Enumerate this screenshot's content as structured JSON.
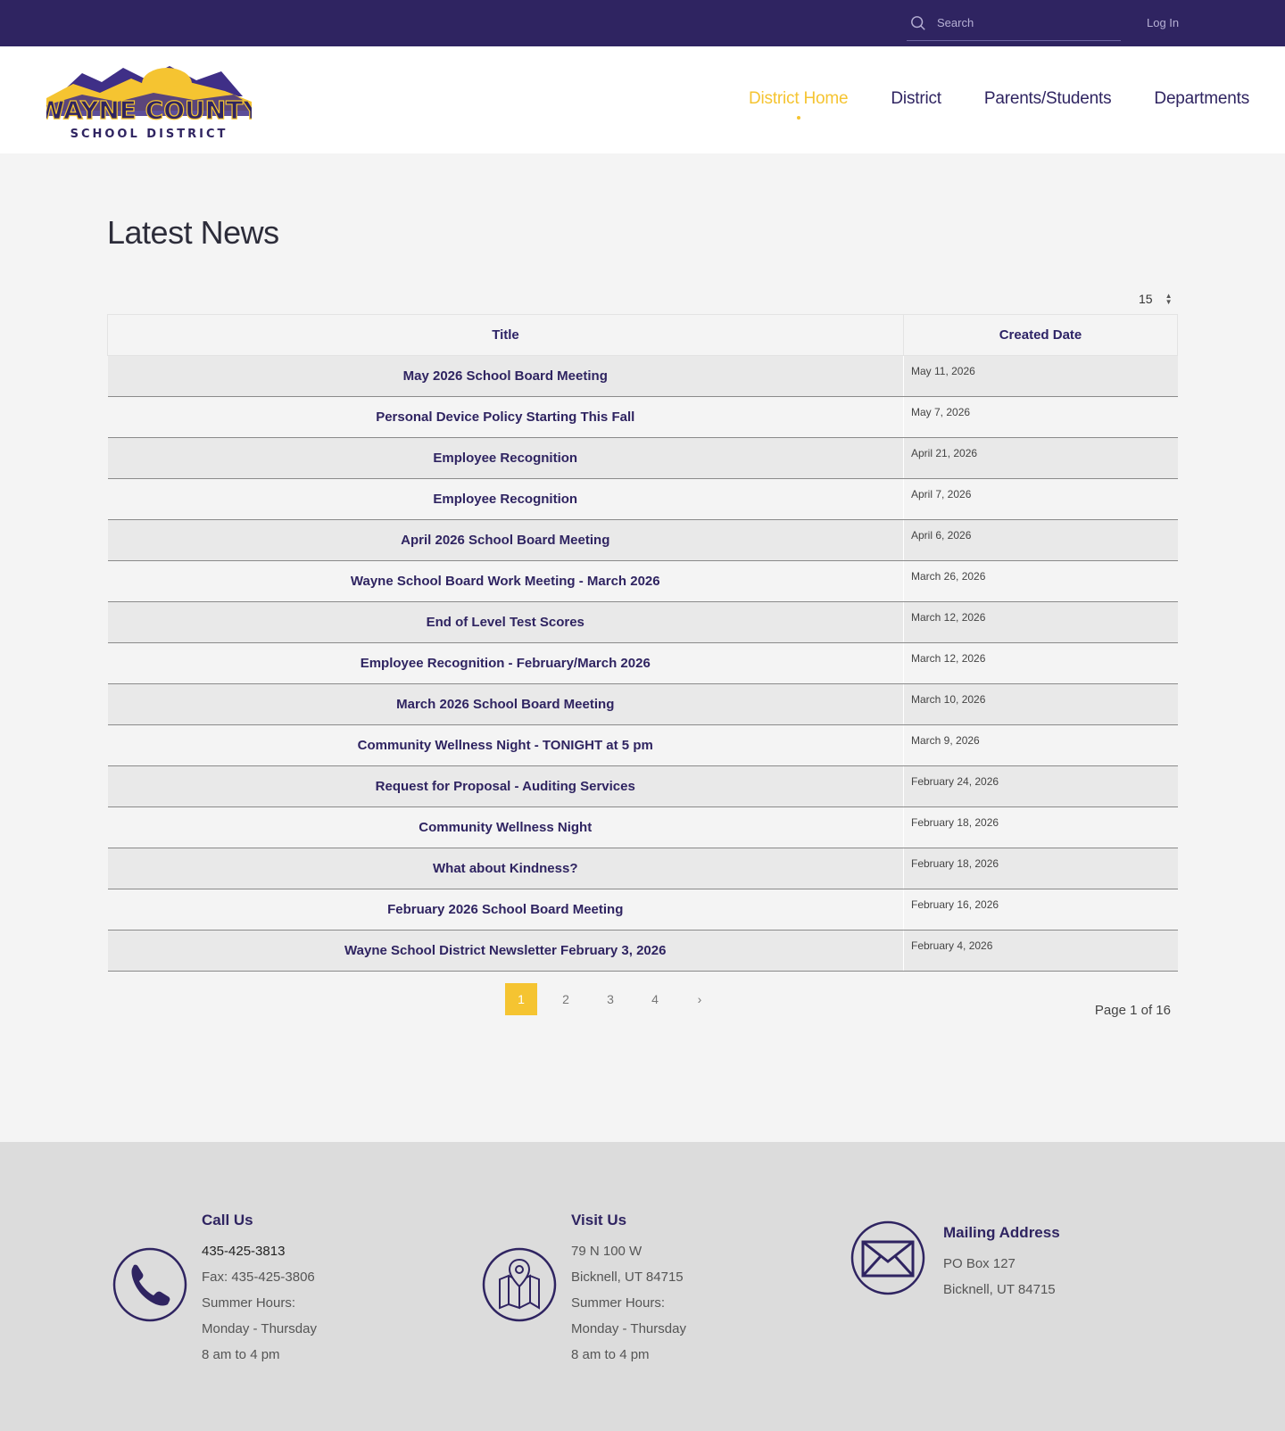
{
  "topbar": {
    "search_placeholder": "Search",
    "login_label": "Log In"
  },
  "header": {
    "logo_line1": "WAYNE COUNTY",
    "logo_line2": "SCHOOL DISTRICT",
    "nav": [
      "District Home",
      "District",
      "Parents/Students",
      "Departments"
    ]
  },
  "main": {
    "title": "Latest News",
    "per_page": "15",
    "columns": [
      "Title",
      "Created Date"
    ],
    "rows": [
      {
        "title": "May 2026 School Board Meeting",
        "date": "May 11, 2026"
      },
      {
        "title": "Personal Device Policy Starting This Fall",
        "date": "May 7, 2026"
      },
      {
        "title": "Employee Recognition",
        "date": "April 21, 2026"
      },
      {
        "title": "Employee Recognition",
        "date": "April 7, 2026"
      },
      {
        "title": "April 2026 School Board Meeting",
        "date": "April 6, 2026"
      },
      {
        "title": "Wayne School Board Work Meeting - March 2026",
        "date": "March 26, 2026"
      },
      {
        "title": "End of Level Test Scores",
        "date": "March 12, 2026"
      },
      {
        "title": "Employee Recognition - February/March 2026",
        "date": "March 12, 2026"
      },
      {
        "title": "March 2026 School Board Meeting",
        "date": "March 10, 2026"
      },
      {
        "title": "Community Wellness Night - TONIGHT at 5 pm",
        "date": "March 9, 2026"
      },
      {
        "title": "Request for Proposal - Auditing Services",
        "date": "February 24, 2026"
      },
      {
        "title": "Community Wellness Night",
        "date": "February 18, 2026"
      },
      {
        "title": "What about Kindness?",
        "date": "February 18, 2026"
      },
      {
        "title": "February 2026 School Board Meeting",
        "date": "February 16, 2026"
      },
      {
        "title": "Wayne School District Newsletter February 3, 2026",
        "date": "February 4, 2026"
      }
    ],
    "pages": [
      "1",
      "2",
      "3",
      "4"
    ],
    "next_label": "›",
    "page_info": "Page 1 of 16"
  },
  "footer": {
    "call": {
      "heading": "Call Us",
      "phone": "435-425-3813",
      "fax": "Fax: 435-425-3806",
      "hours_label": "Summer Hours:",
      "days": "Monday - Thursday",
      "time": "8 am to 4 pm"
    },
    "visit": {
      "heading": "Visit Us",
      "street": "79 N 100 W",
      "city": "Bicknell, UT 84715",
      "hours_label": "Summer Hours:",
      "days": "Monday - Thursday",
      "time": "8 am to 4 pm"
    },
    "mail": {
      "heading": "Mailing Address",
      "box": "PO Box 127",
      "city": "Bicknell, UT 84715"
    }
  },
  "colors": {
    "brand_purple": "#2f2461",
    "accent_gold": "#f5c431"
  }
}
